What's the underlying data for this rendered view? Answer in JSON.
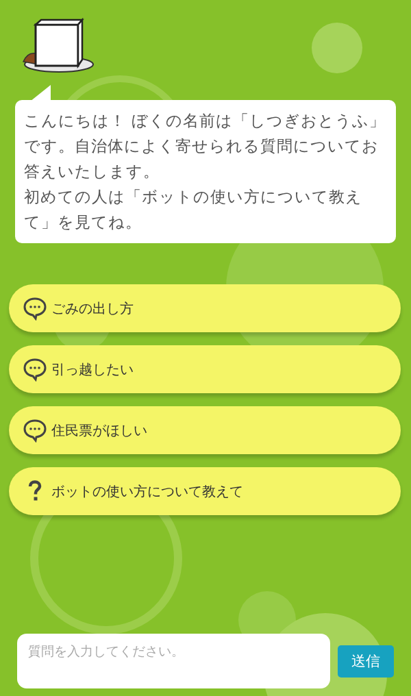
{
  "greeting": {
    "paragraphs": [
      "こんにちは！ ぼくの名前は「しつぎおとうふ」です。自治体によく寄せられる質問についてお答えいたします。",
      "初めての人は「ボットの使い方について教えて」を見てね。"
    ]
  },
  "suggestions": [
    {
      "kind": "chat",
      "label": "ごみの出し方"
    },
    {
      "kind": "chat",
      "label": "引っ越したい"
    },
    {
      "kind": "chat",
      "label": "住民票がほしい"
    },
    {
      "kind": "help",
      "label": "ボットの使い方について教えて"
    }
  ],
  "input": {
    "placeholder": "質問を入力してください。"
  },
  "send_button": {
    "label": "送信"
  }
}
